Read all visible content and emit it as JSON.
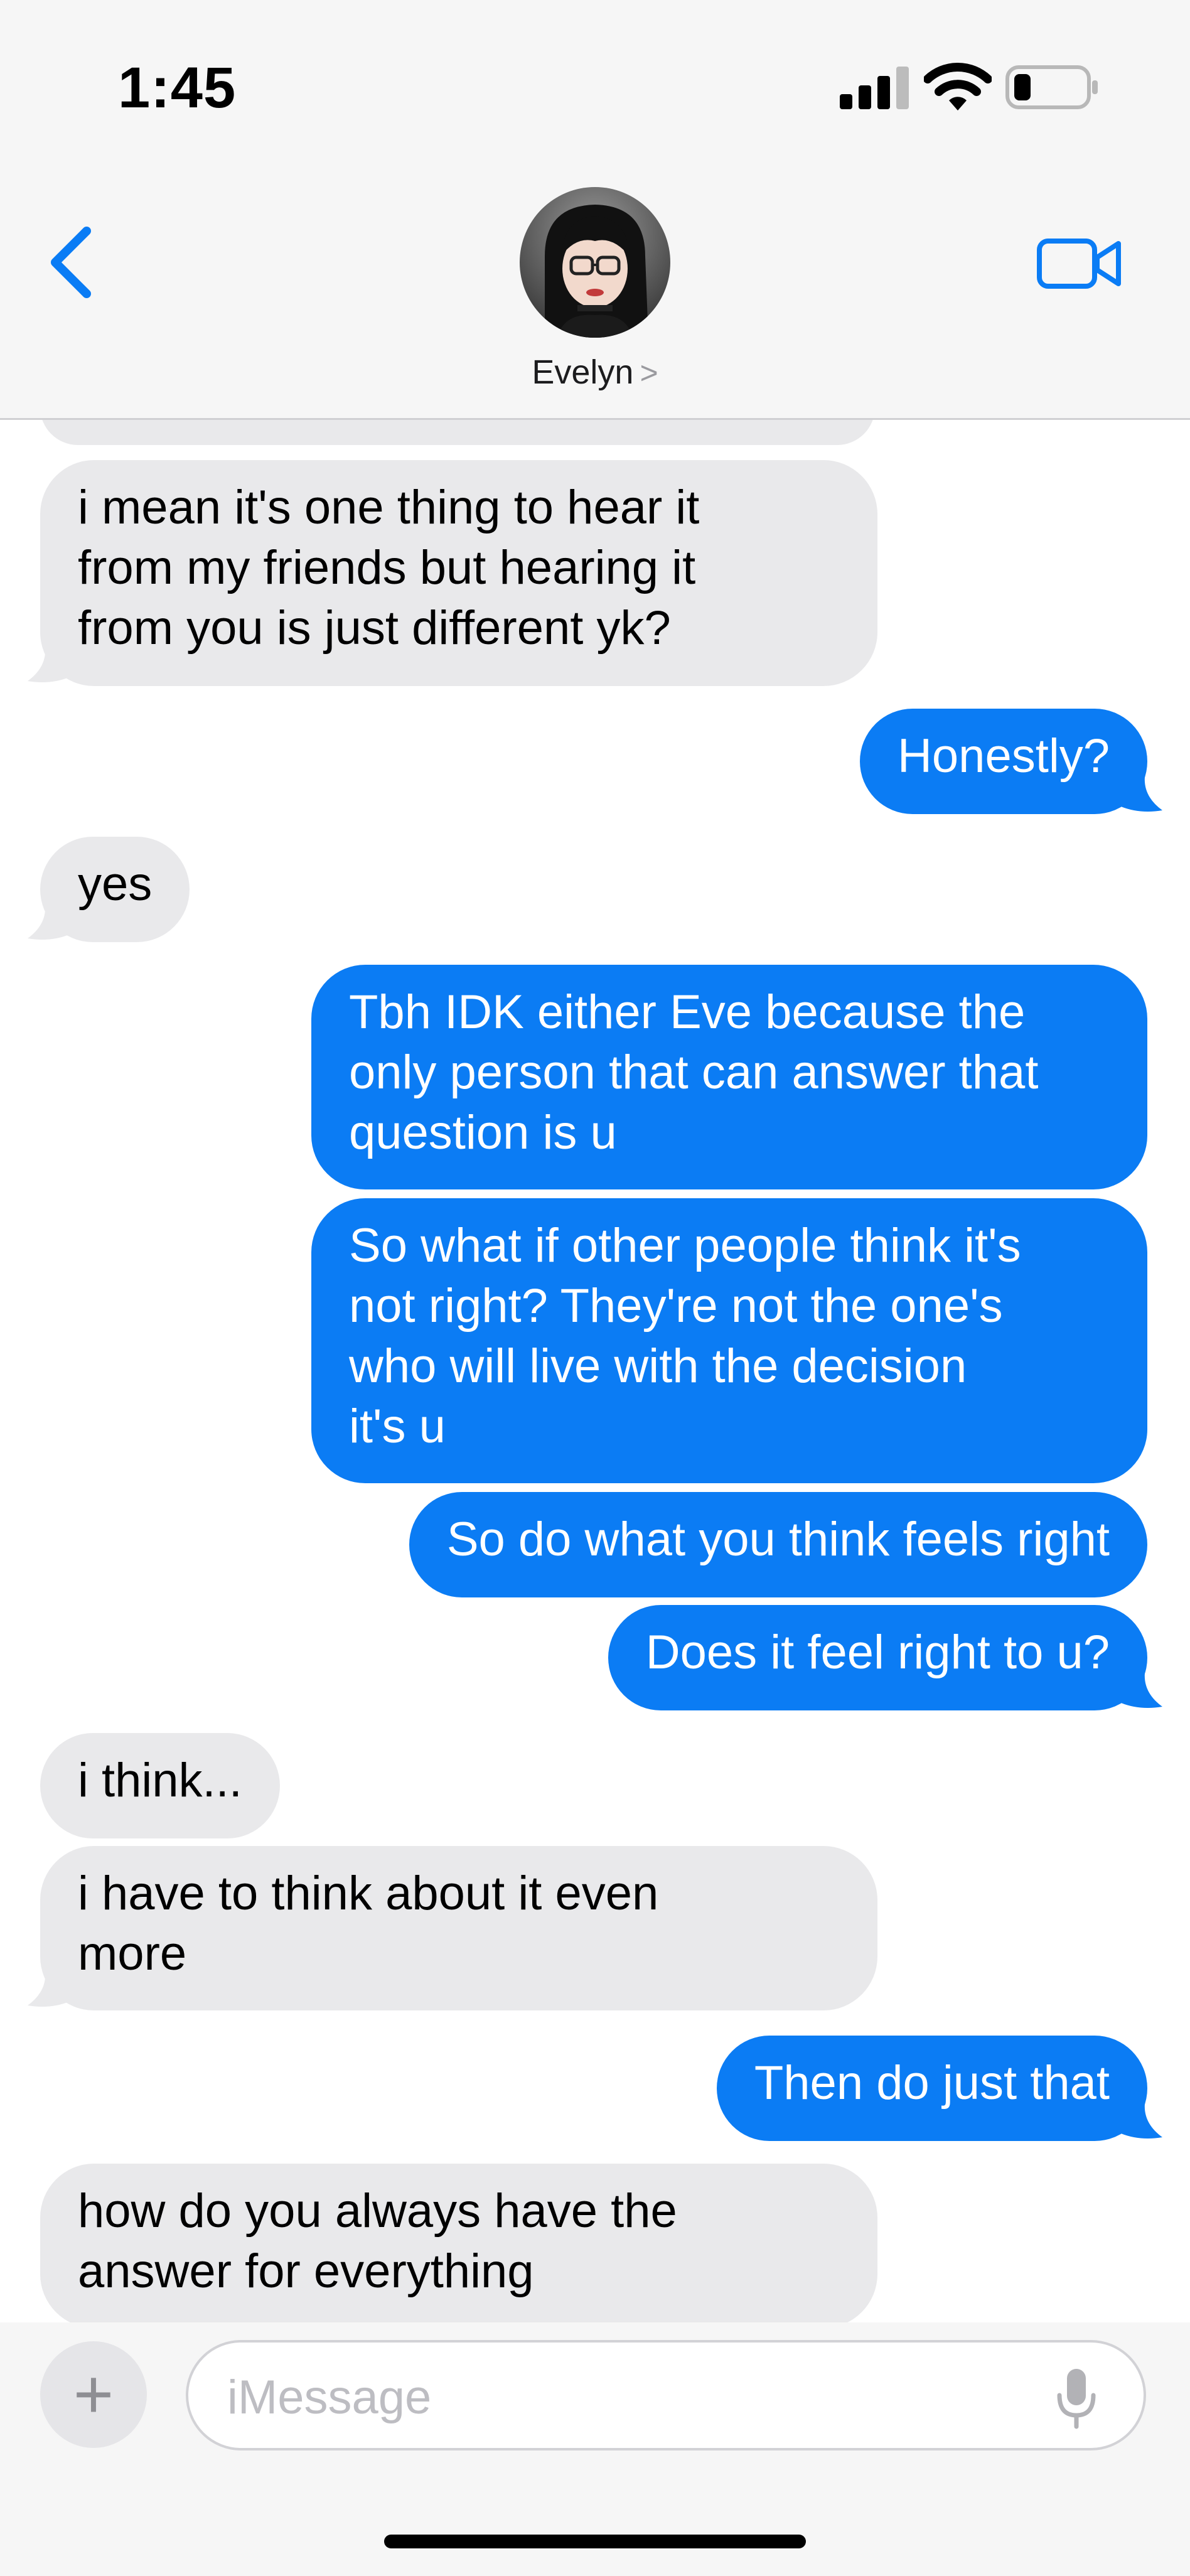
{
  "status_bar": {
    "time": "1:45",
    "signal_icon": "cellular-signal-icon",
    "wifi_icon": "wifi-icon",
    "battery_icon": "battery-low-icon"
  },
  "header": {
    "contact_name": "Evelyn",
    "chevron": ">",
    "back_icon": "chevron-left-icon",
    "video_icon": "video-camera-icon",
    "avatar": "contact-photo"
  },
  "messages": [
    {
      "from": "contact",
      "text": "i mean it's one thing to hear it\nfrom my friends but hearing it\nfrom you is just different yk?"
    },
    {
      "from": "me",
      "text": "Honestly?"
    },
    {
      "from": "contact",
      "text": "yes"
    },
    {
      "from": "me",
      "text": "Tbh IDK either Eve because the\nonly person that can answer that\nquestion is u"
    },
    {
      "from": "me",
      "text": "So what if other people think it's\nnot right? They're not the one's\nwho will live with the decision\nit's u"
    },
    {
      "from": "me",
      "text": "So do what you think feels right"
    },
    {
      "from": "me",
      "text": "Does it feel right to u?"
    },
    {
      "from": "contact",
      "text": "i think..."
    },
    {
      "from": "contact",
      "text": "i have to think about it even\nmore"
    },
    {
      "from": "me",
      "text": "Then do just that"
    },
    {
      "from": "contact",
      "text": "how do you always have the\nanswer for everything"
    }
  ],
  "input": {
    "plus_label": "+",
    "placeholder": "iMessage",
    "mic_icon": "microphone-icon"
  },
  "colors": {
    "outgoing": "#0b7cf4",
    "incoming": "#e9e9eb",
    "accent": "#0a7cf5"
  }
}
